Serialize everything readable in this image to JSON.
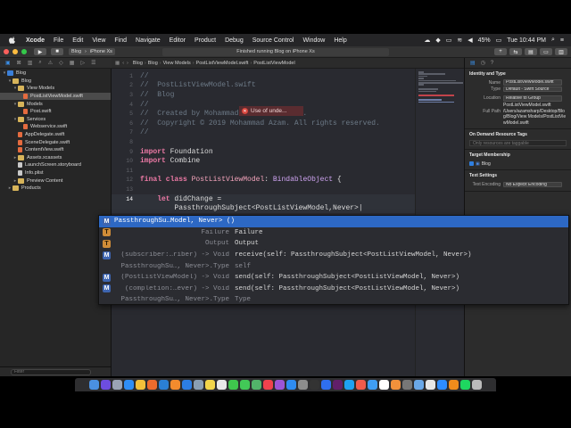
{
  "menubar": {
    "app": "Xcode",
    "items": [
      "File",
      "Edit",
      "View",
      "Find",
      "Navigate",
      "Editor",
      "Product",
      "Debug",
      "Source Control",
      "Window",
      "Help"
    ],
    "battery": "45%",
    "clock": "Tue 10:44 PM"
  },
  "toolbar": {
    "scheme_target": "Blog",
    "scheme_device": "iPhone Xs",
    "status": "Finished running Blog on iPhone Xs"
  },
  "navigator": {
    "items": [
      {
        "label": "Blog",
        "kind": "proj",
        "level": 0
      },
      {
        "label": "Blog",
        "kind": "folder",
        "level": 1
      },
      {
        "label": "View Models",
        "kind": "folder",
        "level": 2
      },
      {
        "label": "PostListViewModel.swift",
        "kind": "swift",
        "level": 3,
        "selected": true
      },
      {
        "label": "Models",
        "kind": "folder",
        "level": 2
      },
      {
        "label": "Post.swift",
        "kind": "swift",
        "level": 3
      },
      {
        "label": "Services",
        "kind": "folder",
        "level": 2
      },
      {
        "label": "Webservice.swift",
        "kind": "swift",
        "level": 3
      },
      {
        "label": "AppDelegate.swift",
        "kind": "swift",
        "level": 2
      },
      {
        "label": "SceneDelegate.swift",
        "kind": "swift",
        "level": 2
      },
      {
        "label": "ContentView.swift",
        "kind": "swift",
        "level": 2
      },
      {
        "label": "Assets.xcassets",
        "kind": "folder",
        "level": 2
      },
      {
        "label": "LaunchScreen.storyboard",
        "kind": "file",
        "level": 2
      },
      {
        "label": "Info.plist",
        "kind": "file",
        "level": 2
      },
      {
        "label": "Preview Content",
        "kind": "folder",
        "level": 2
      },
      {
        "label": "Products",
        "kind": "folder",
        "level": 1
      }
    ],
    "filter_placeholder": "Filter"
  },
  "jumpbar": {
    "crumbs": [
      "Blog",
      "Blog",
      "View Models",
      "PostListViewModel.swift",
      "PostListViewModel"
    ]
  },
  "editor": {
    "lines": [
      {
        "n": "1",
        "parts": [
          {
            "c": "cmt",
            "t": "//"
          }
        ]
      },
      {
        "n": "2",
        "parts": [
          {
            "c": "cmt",
            "t": "//  PostListViewModel.swift"
          }
        ]
      },
      {
        "n": "3",
        "parts": [
          {
            "c": "cmt",
            "t": "//  Blog"
          }
        ]
      },
      {
        "n": "4",
        "parts": [
          {
            "c": "cmt",
            "t": "//"
          }
        ]
      },
      {
        "n": "5",
        "parts": [
          {
            "c": "cmt",
            "t": "//  Created by Mohammad Azam on 6/4/19."
          }
        ]
      },
      {
        "n": "6",
        "parts": [
          {
            "c": "cmt",
            "t": "//  Copyright © 2019 Mohammad Azam. All rights reserved."
          }
        ]
      },
      {
        "n": "7",
        "parts": [
          {
            "c": "cmt",
            "t": "//"
          }
        ]
      },
      {
        "n": "8",
        "parts": []
      },
      {
        "n": "9",
        "parts": [
          {
            "c": "kw",
            "t": "import"
          },
          {
            "c": "plain",
            "t": " Foundation"
          }
        ]
      },
      {
        "n": "10",
        "parts": [
          {
            "c": "kw",
            "t": "import"
          },
          {
            "c": "plain",
            "t": " Combine"
          }
        ]
      },
      {
        "n": "11",
        "parts": []
      },
      {
        "n": "12",
        "parts": [
          {
            "c": "kw",
            "t": "final class"
          },
          {
            "c": "plain",
            "t": " "
          },
          {
            "c": "cls",
            "t": "PostListViewModel"
          },
          {
            "c": "plain",
            "t": ": "
          },
          {
            "c": "ty",
            "t": "BindableObject"
          },
          {
            "c": "plain",
            "t": " {"
          }
        ]
      },
      {
        "n": "13",
        "parts": []
      },
      {
        "n": "14",
        "parts": [
          {
            "c": "plain",
            "t": "    "
          },
          {
            "c": "kw",
            "t": "let"
          },
          {
            "c": "plain",
            "t": " didChange ="
          }
        ],
        "current": true
      },
      {
        "n": "",
        "parts": [
          {
            "c": "plain",
            "t": "        PassthroughSubject<PostListViewModel,Never>|"
          }
        ],
        "current": true
      }
    ],
    "error_text": "Use of unde..."
  },
  "completion": {
    "rows": [
      {
        "badge": "M",
        "ret": "",
        "name": "PassthroughSu…Model, Never> ()",
        "selected": true
      },
      {
        "badge": "T",
        "ret": "Failure",
        "name": "Failure"
      },
      {
        "badge": "T",
        "ret": "Output",
        "name": "Output"
      },
      {
        "badge": "M",
        "ret": "(subscriber:…riber) -> Void",
        "name": "receive(self: PassthroughSubject<PostListViewModel, Never>)"
      },
      {
        "badge": "",
        "ret": "PassthroughSu…, Never>.Type",
        "name": "self"
      },
      {
        "badge": "M",
        "ret": "(PostListViewModel) -> Void",
        "name": "send(self: PassthroughSubject<PostListViewModel, Never>)"
      },
      {
        "badge": "M",
        "ret": "(completion:…ever) -> Void",
        "name": "send(self: PassthroughSubject<PostListViewModel, Never>)"
      },
      {
        "badge": "",
        "ret": "PassthroughSu…, Never>.Type",
        "name": "Type"
      }
    ]
  },
  "inspector": {
    "identity": {
      "title": "Identity and Type",
      "name_label": "Name",
      "name_value": "PostListViewModel.swift",
      "type_label": "Type",
      "type_value": "Default - Swift Source",
      "location_label": "Location",
      "location_value": "Relative to Group",
      "location_file": "PostListViewModel.swift",
      "fullpath_label": "Full Path",
      "fullpath_value": "/Users/azamsharp/Desktop/Blog/Blog/View Models/PostListViewModel.swift"
    },
    "odr": {
      "title": "On Demand Resource Tags",
      "hint": "Only resources are taggable"
    },
    "membership": {
      "title": "Target Membership",
      "target": "Blog"
    },
    "text": {
      "title": "Text Settings",
      "encoding_label": "Text Encoding",
      "encoding_value": "No Explicit Encoding"
    }
  },
  "colors": {
    "accent": "#2d68c4",
    "keyword": "#ee7aa6",
    "comment": "#6c7986",
    "error": "#d8453c"
  }
}
